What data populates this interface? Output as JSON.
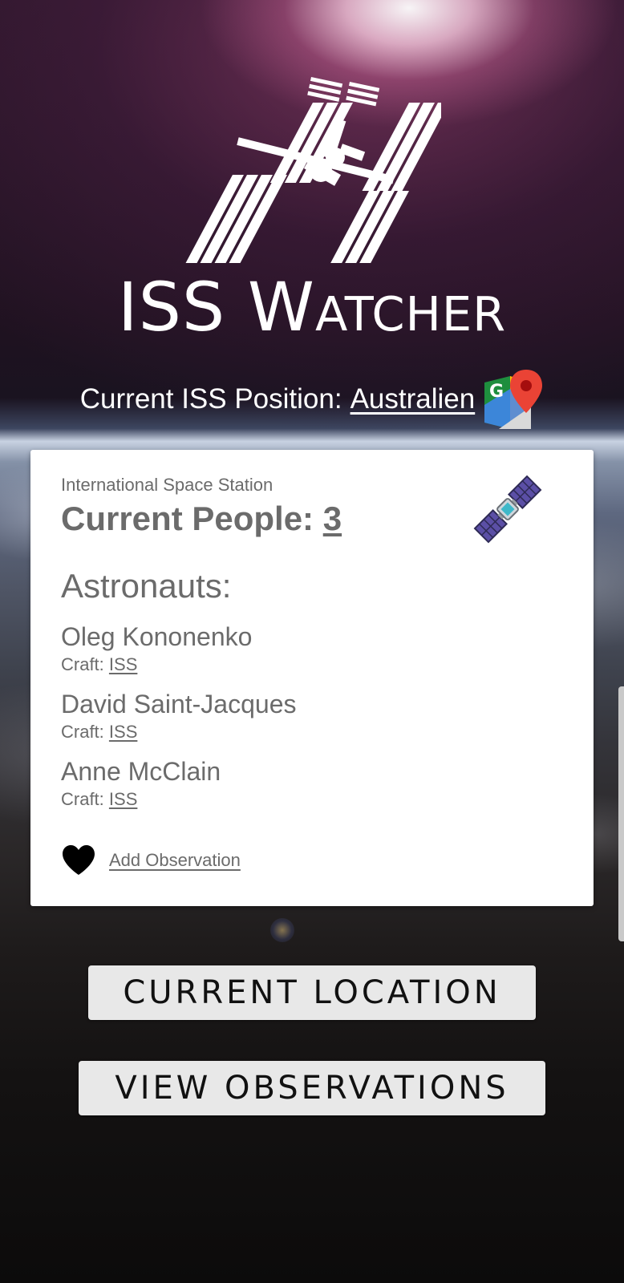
{
  "header": {
    "app_title": "ISS Watcher",
    "position_label": "Current ISS Position:",
    "position_value": "Australien",
    "logo_icon": "space-station-icon",
    "maps_icon": "google-maps-icon"
  },
  "card": {
    "subtitle": "International Space Station",
    "people_label": "Current People: ",
    "people_count": "3",
    "satellite_icon": "satellite-icon",
    "astronauts_heading": "Astronauts:",
    "craft_label": "Craft: ",
    "astronauts": [
      {
        "name": "Oleg Kononenko",
        "craft": "ISS"
      },
      {
        "name": "David Saint-Jacques",
        "craft": "ISS"
      },
      {
        "name": "Anne McClain",
        "craft": "ISS"
      }
    ],
    "heart_icon": "heart-icon",
    "add_observation": "Add Observation"
  },
  "buttons": {
    "current_location": "CURRENT LOCATION",
    "view_observations": "VIEW OBSERVATIONS"
  },
  "colors": {
    "card_background": "#ffffff",
    "card_text": "#6b6b6b",
    "button_background": "#e8e8e8",
    "button_text": "#111111"
  }
}
